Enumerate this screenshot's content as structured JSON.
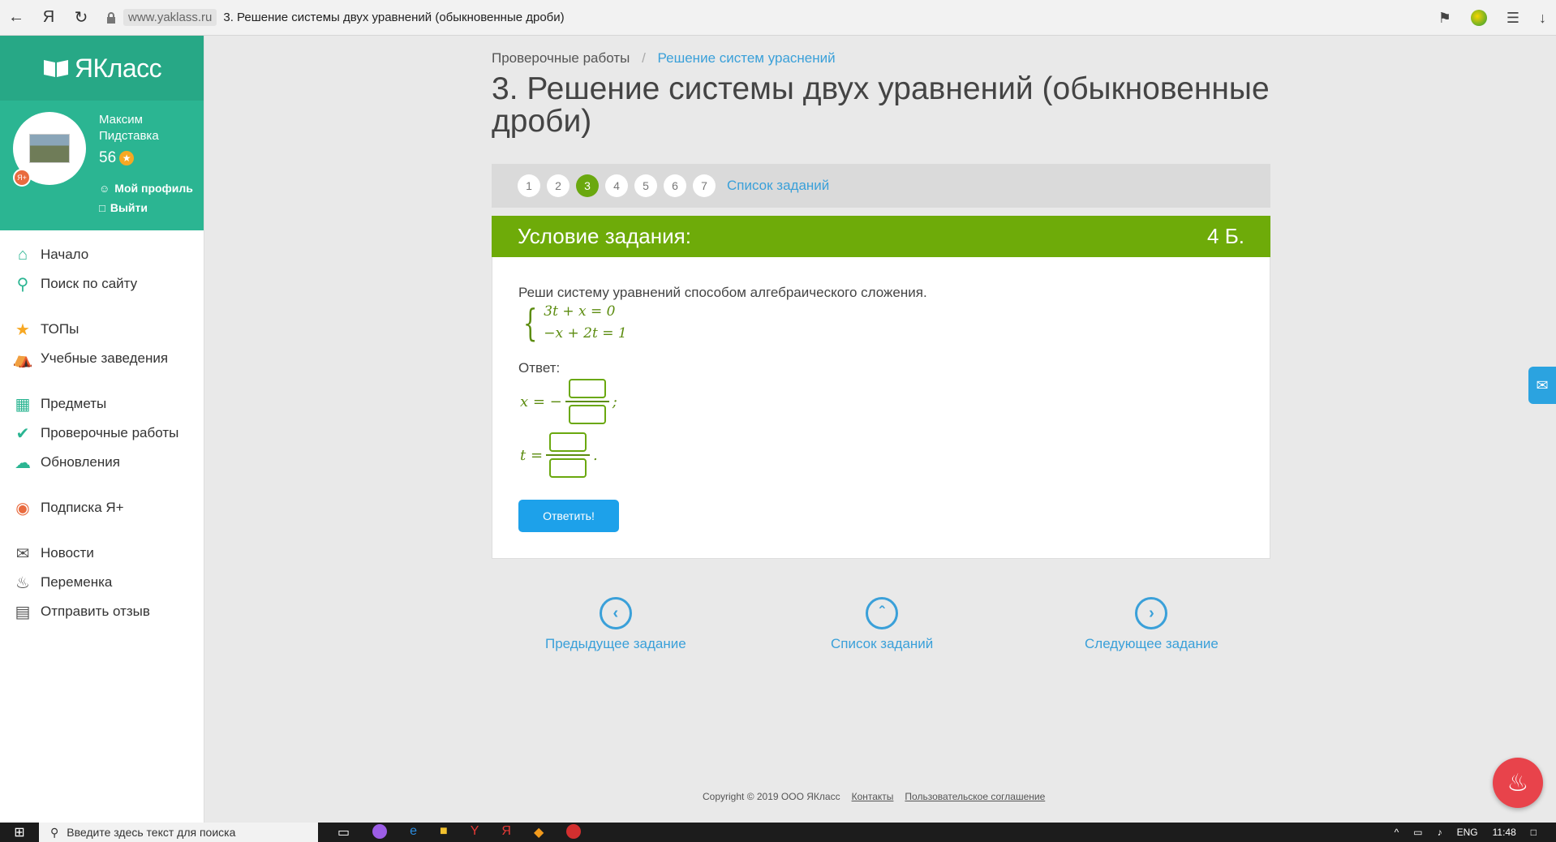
{
  "browser": {
    "domain": "www.yaklass.ru",
    "tab_title": "3. Решение системы двух уравнений (обыкновенные дроби)"
  },
  "sidebar": {
    "logo_text": "ЯКласс",
    "user": {
      "first_name": "Максим",
      "last_name": "Пидставка",
      "points": "56"
    },
    "profile_link": "Мой профиль",
    "logout_link": "Выйти",
    "menu_groups": [
      [
        {
          "label": "Начало",
          "icon": "home-icon"
        },
        {
          "label": "Поиск по сайту",
          "icon": "search-icon"
        }
      ],
      [
        {
          "label": "ТОПы",
          "icon": "star-icon"
        },
        {
          "label": "Учебные заведения",
          "icon": "institution-icon"
        }
      ],
      [
        {
          "label": "Предметы",
          "icon": "book-icon"
        },
        {
          "label": "Проверочные работы",
          "icon": "check-icon"
        },
        {
          "label": "Обновления",
          "icon": "cloud-icon"
        }
      ],
      [
        {
          "label": "Подписка Я+",
          "icon": "subscription-icon"
        }
      ],
      [
        {
          "label": "Новости",
          "icon": "megaphone-icon"
        },
        {
          "label": "Переменка",
          "icon": "bell-icon"
        },
        {
          "label": "Отправить отзыв",
          "icon": "feedback-icon"
        }
      ]
    ]
  },
  "breadcrumb": {
    "parent": "Проверочные работы",
    "current": "Решение систем урaснений"
  },
  "page_title": "3. Решение системы двух уравнений (обыкновенные дроби)",
  "pager": {
    "pages": [
      "1",
      "2",
      "3",
      "4",
      "5",
      "6",
      "7"
    ],
    "active": "3",
    "list_label": "Список заданий"
  },
  "task": {
    "header_title": "Условие задания:",
    "points": "4 Б.",
    "text": "Реши систему уравнений способом алгебраического сложения.",
    "equations": [
      "3t + x = 0",
      "−x + 2t = 1"
    ],
    "answer_label": "Ответ:",
    "x_prefix": "x = −",
    "x_suffix": ";",
    "t_prefix": "t =",
    "t_suffix": ".",
    "submit_label": "Ответить!"
  },
  "bottom_nav": {
    "prev": "Предыдущее задание",
    "list": "Список заданий",
    "next": "Следующее задание"
  },
  "footer": {
    "copyright": "Copyright © 2019 ООО ЯКласс",
    "contacts": "Контакты",
    "agreement": "Пользовательское соглашение"
  },
  "taskbar": {
    "search_placeholder": "Введите здесь текст для поиска",
    "lang": "ENG",
    "time": "11:48"
  },
  "colors": {
    "green_header": "#6eab09",
    "sidebar_green": "#2bb592",
    "link_blue": "#3aa0d9",
    "button_blue": "#1da1ea"
  }
}
